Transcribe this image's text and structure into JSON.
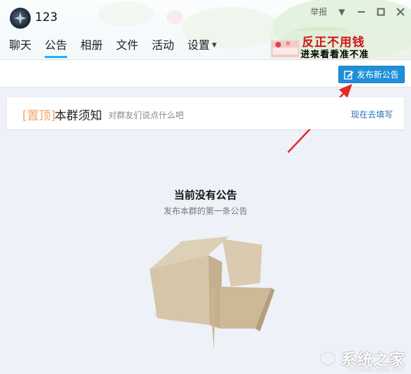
{
  "window": {
    "group_name": "123",
    "report_label": "举报",
    "controls": [
      "menu-caret",
      "minimize",
      "maximize",
      "close"
    ]
  },
  "tabs": [
    {
      "label": "聊天",
      "active": false
    },
    {
      "label": "公告",
      "active": true
    },
    {
      "label": "相册",
      "active": false
    },
    {
      "label": "文件",
      "active": false
    },
    {
      "label": "活动",
      "active": false
    },
    {
      "label": "设置",
      "active": false,
      "has_dropdown": true
    }
  ],
  "promo": {
    "line1": "反正不用钱",
    "line2": "进来看看准不准"
  },
  "toolbar": {
    "publish_label": "发布新公告",
    "publish_icon": "edit-icon"
  },
  "pinned": {
    "tag": "[置顶]",
    "title": "本群须知",
    "subtitle": "对群友们说点什么吧",
    "link": "现在去填写"
  },
  "empty_state": {
    "title": "当前没有公告",
    "subtitle": "发布本群的第一条公告"
  },
  "watermark": {
    "text": "系统之家",
    "sub": "XITONGZHIJIA.NET"
  },
  "colors": {
    "accent": "#12b7f5",
    "button": "#1f8fd9",
    "link": "#2a6fb3",
    "pin_tag": "#f3a46a",
    "arrow": "#e02a2a",
    "background": "#eef2f8"
  }
}
